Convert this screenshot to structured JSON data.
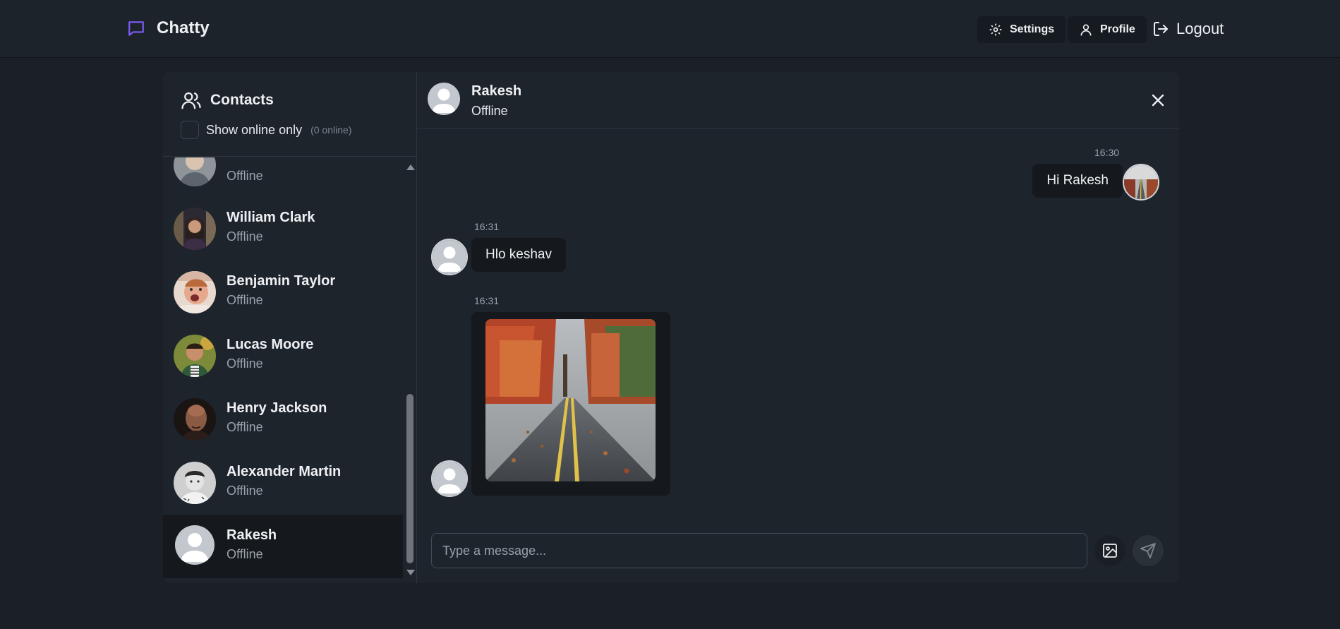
{
  "app": {
    "name": "Chatty",
    "brand_color": "#7c5cf6",
    "logo_icon": "message-square-icon"
  },
  "nav": {
    "settings_label": "Settings",
    "profile_label": "Profile",
    "logout_label": "Logout"
  },
  "sidebar": {
    "title": "Contacts",
    "filter_label": "Show online only",
    "online_count": "(0 online)",
    "contacts": [
      {
        "name": "",
        "status": "Offline"
      },
      {
        "name": "William Clark",
        "status": "Offline"
      },
      {
        "name": "Benjamin Taylor",
        "status": "Offline"
      },
      {
        "name": "Lucas Moore",
        "status": "Offline"
      },
      {
        "name": "Henry Jackson",
        "status": "Offline"
      },
      {
        "name": "Alexander Martin",
        "status": "Offline"
      },
      {
        "name": "Rakesh",
        "status": "Offline"
      }
    ]
  },
  "chat": {
    "header": {
      "name": "Rakesh",
      "status": "Offline"
    },
    "messages": [
      {
        "time": "16:30",
        "text": "Hi Rakesh",
        "direction": "outgoing"
      },
      {
        "time": "16:31",
        "text": "Hlo keshav",
        "direction": "incoming"
      },
      {
        "time": "16:31",
        "text": "",
        "direction": "incoming",
        "attachment": "autumn-road-photo"
      }
    ],
    "composer": {
      "placeholder": "Type a message..."
    }
  }
}
